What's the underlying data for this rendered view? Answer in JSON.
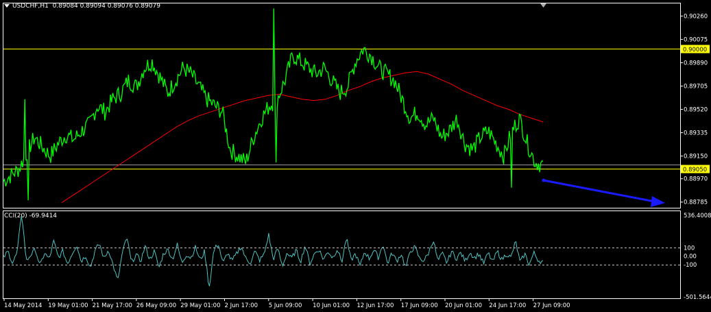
{
  "header": {
    "symbol": "USDCHF,H1",
    "ohlc": "0.89084 0.89094 0.89076 0.89079"
  },
  "indicator": {
    "label": "CCI(20) -69.9414"
  },
  "colors": {
    "background": "#000000",
    "price": "#00ff00",
    "moving_average": "#ff0000",
    "level_line": "#ffff00",
    "cci": "#4fc3c3",
    "arrow": "#1a1aff",
    "frame": "#ffffff"
  },
  "chart_data": [
    {
      "type": "line",
      "panel": "price",
      "symbol": "USDCHF",
      "timeframe": "H1",
      "y_ticks": [
        "0.90260",
        "0.90075",
        "0.89890",
        "0.89705",
        "0.89520",
        "0.89335",
        "0.89150",
        "0.88970",
        "0.88785"
      ],
      "ylim": [
        0.8874,
        0.9036
      ],
      "x_ticks": [
        "14 May 2014",
        "19 May 01:00",
        "21 May 17:00",
        "26 May 09:00",
        "29 May 01:00",
        "2 Jun 17:00",
        "5 Jun 09:00",
        "10 Jun 01:00",
        "12 Jun 17:00",
        "17 Jun 09:00",
        "20 Jun 01:00",
        "24 Jun 17:00",
        "27 Jun 09:00"
      ],
      "horizontal_levels": [
        {
          "label": "0.90000",
          "value": 0.9,
          "color": "#ffff00"
        },
        {
          "label": "0.89050",
          "value": 0.8905,
          "color": "#ffff00"
        }
      ],
      "series": [
        {
          "kind": "close",
          "color": "#00ff00",
          "values": [
            0.8895,
            0.89,
            0.8905,
            0.8918,
            0.893,
            0.8922,
            0.8915,
            0.8925,
            0.8932,
            0.8928,
            0.8935,
            0.894,
            0.8955,
            0.895,
            0.896,
            0.8965,
            0.8975,
            0.897,
            0.8985,
            0.899,
            0.8978,
            0.8965,
            0.8975,
            0.8985,
            0.898,
            0.897,
            0.896,
            0.8955,
            0.895,
            0.892,
            0.8915,
            0.891,
            0.893,
            0.8945,
            0.8955,
            0.896,
            0.8975,
            0.8995,
            0.899,
            0.8985,
            0.898,
            0.8985,
            0.8975,
            0.8965,
            0.897,
            0.899,
            0.9,
            0.8995,
            0.8985,
            0.898,
            0.8975,
            0.896,
            0.8945,
            0.895,
            0.894,
            0.8945,
            0.893,
            0.8935,
            0.8945,
            0.8925,
            0.892,
            0.893,
            0.8935,
            0.8925,
            0.8915,
            0.8935,
            0.8945,
            0.8925,
            0.891,
            0.8908
          ]
        },
        {
          "kind": "moving_average",
          "color": "#ff0000",
          "values": [
            0.8878,
            0.8884,
            0.889,
            0.8896,
            0.8902,
            0.8908,
            0.8914,
            0.892,
            0.8926,
            0.8932,
            0.8938,
            0.8943,
            0.8947,
            0.895,
            0.8953,
            0.8956,
            0.8959,
            0.8961,
            0.8963,
            0.8964,
            0.8962,
            0.896,
            0.8959,
            0.896,
            0.8963,
            0.8967,
            0.897,
            0.8974,
            0.8977,
            0.8979,
            0.8981,
            0.8982,
            0.898,
            0.8976,
            0.8972,
            0.8967,
            0.8963,
            0.8959,
            0.8955,
            0.8952,
            0.8948,
            0.8945,
            0.8942
          ]
        }
      ]
    },
    {
      "type": "line",
      "panel": "indicator",
      "title": "CCI(20) -69.9414",
      "y_ticks": [
        "536.4008",
        "100",
        "0.00",
        "-100",
        "-501.5644"
      ],
      "ylim": [
        -501.5644,
        536.4008
      ],
      "levels": [
        100,
        -100
      ],
      "series": [
        {
          "name": "CCI(20)",
          "color": "#4fc3c3",
          "values": [
            -20,
            60,
            -80,
            40,
            520,
            -60,
            20,
            80,
            -120,
            40,
            -40,
            180,
            -20,
            60,
            -90,
            30,
            140,
            -60,
            10,
            -140,
            60,
            150,
            -30,
            80,
            -110,
            -300,
            40,
            220,
            -80,
            20,
            -60,
            120,
            -40,
            60,
            -140,
            30,
            80,
            -40,
            140,
            -80,
            20,
            -20,
            110,
            -50,
            60,
            -380,
            70,
            150,
            -90,
            40,
            -60,
            30,
            120,
            -30,
            -80,
            60,
            -50,
            20,
            260,
            -40,
            90,
            -120,
            40,
            -30,
            70,
            -60,
            130,
            -90,
            30,
            80,
            -40,
            60,
            -20,
            90,
            -70,
            220,
            -50,
            30,
            -120,
            60,
            -30,
            80,
            -20,
            150,
            -90,
            40,
            -60,
            30,
            -140,
            60,
            110,
            -30,
            -50,
            40,
            200,
            -60,
            30,
            -80,
            60,
            -30,
            40,
            -60,
            50,
            -20,
            30,
            -90,
            40,
            -70,
            60,
            -40,
            30,
            -20,
            180,
            -80,
            30,
            -100,
            40,
            -50,
            -69.9414
          ]
        }
      ]
    }
  ]
}
